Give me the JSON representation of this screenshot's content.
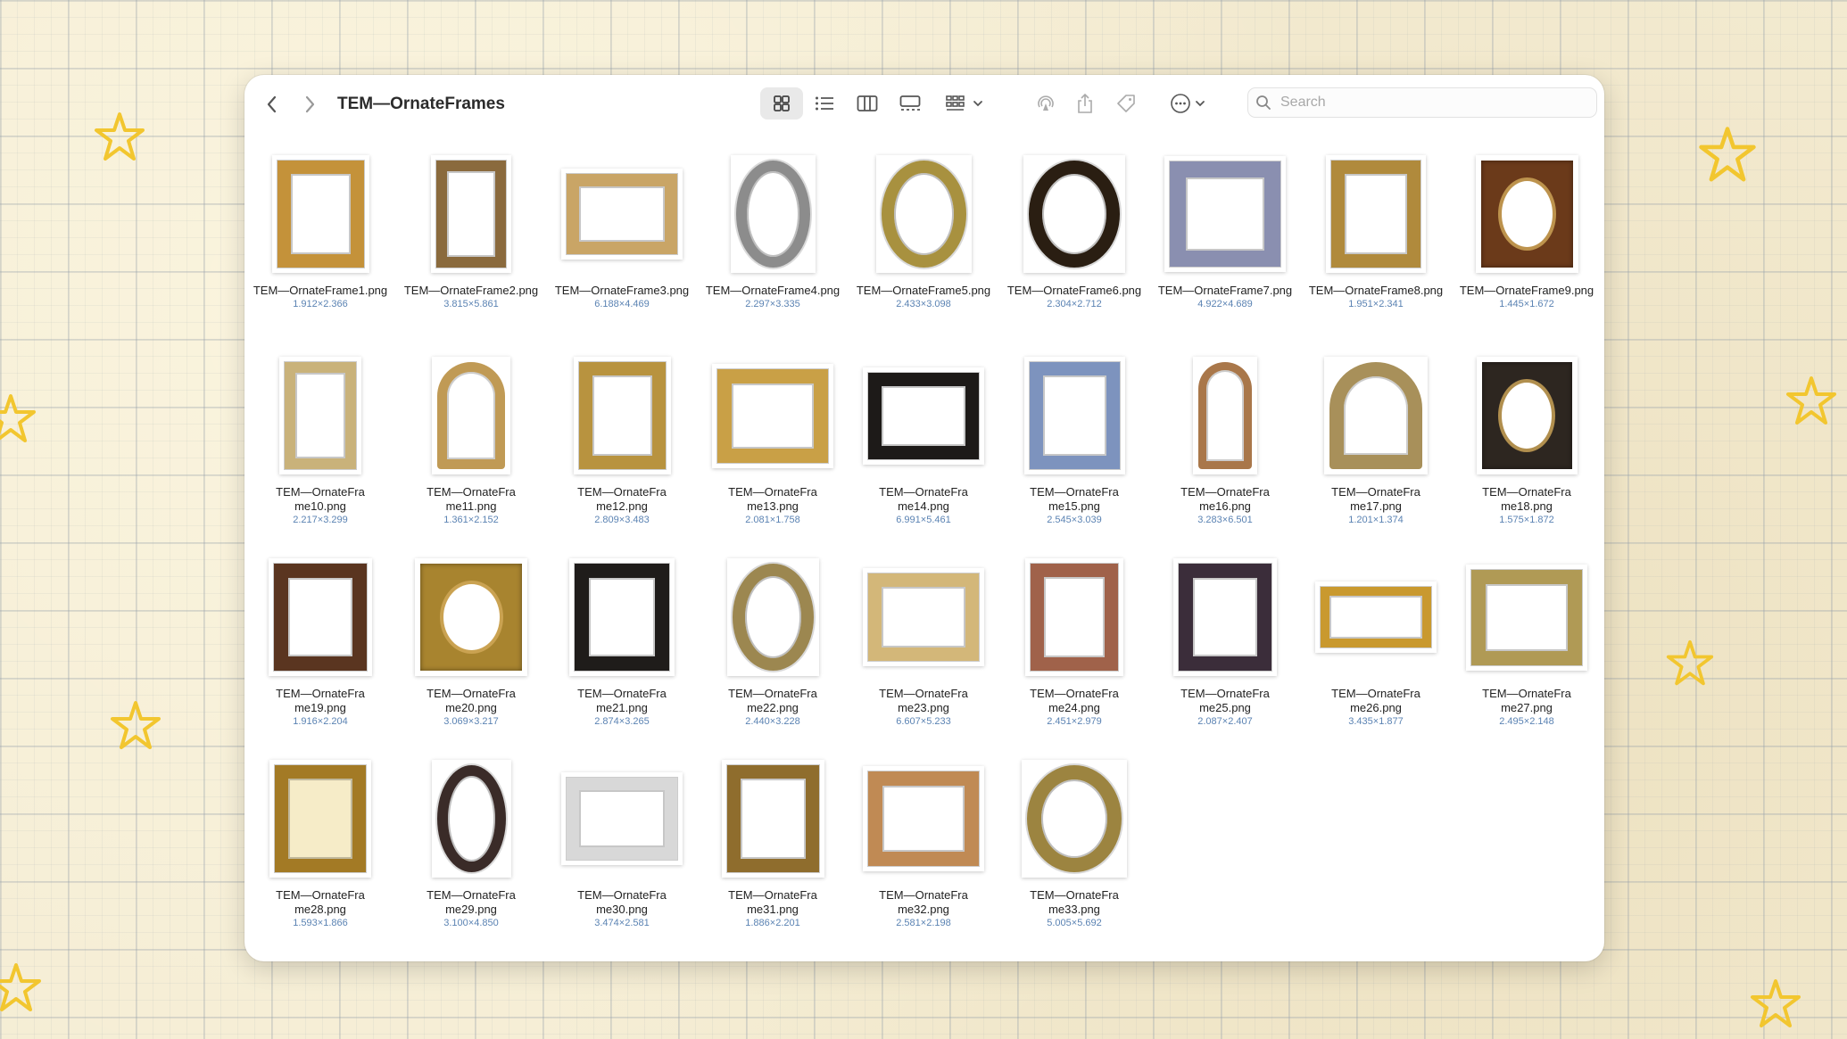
{
  "window": {
    "title": "TEM—OrnateFrames",
    "search_placeholder": "Search"
  },
  "toolbar": {
    "back_icon": "chevron-left-icon",
    "forward_icon": "chevron-right-icon",
    "view_icons": [
      "icon-view-icon",
      "list-view-icon",
      "column-view-icon",
      "gallery-view-icon"
    ],
    "group_icon": "group-icon",
    "airdrop_icon": "airdrop-icon",
    "share_icon": "share-icon",
    "tag_icon": "tag-icon",
    "more_icon": "more-icon"
  },
  "colors": {
    "window_bg": "#ffffff",
    "dims_text": "#5b83b3",
    "selected_view_bg": "#e9e9e9",
    "paper_bg": "#f4ecd3",
    "star": "#f2c62f"
  },
  "files": [
    {
      "name": "TEM—OrnateFrame1.png",
      "dims": "1.912×2.366",
      "style": {
        "color": "#c4923a",
        "shape": "rect",
        "ratio": 0.81,
        "inner": "#ffffff"
      }
    },
    {
      "name": "TEM—OrnateFrame2.png",
      "dims": "3.815×5.861",
      "style": {
        "color": "#8a6a3d",
        "shape": "rect",
        "ratio": 0.65,
        "inner": "#ffffff"
      }
    },
    {
      "name": "TEM—OrnateFrame3.png",
      "dims": "6.188×4.469",
      "style": {
        "color": "#c9a566",
        "shape": "rect",
        "ratio": 1.38,
        "inner": "#ffffff"
      }
    },
    {
      "name": "TEM—OrnateFrame4.png",
      "dims": "2.297×3.335",
      "style": {
        "color": "#8c8c8c",
        "shape": "oval",
        "ratio": 0.69,
        "inner": "#ffffff"
      }
    },
    {
      "name": "TEM—OrnateFrame5.png",
      "dims": "2.433×3.098",
      "style": {
        "color": "#a8913f",
        "shape": "oval",
        "ratio": 0.79,
        "inner": "#ffffff"
      }
    },
    {
      "name": "TEM—OrnateFrame6.png",
      "dims": "2.304×2.712",
      "style": {
        "color": "#2a1e12",
        "shape": "oval",
        "ratio": 0.85,
        "inner": "#ffffff"
      }
    },
    {
      "name": "TEM—OrnateFrame7.png",
      "dims": "4.922×4.689",
      "style": {
        "color": "#8a8fb0",
        "shape": "rect",
        "ratio": 1.05,
        "inner": "#ffffff"
      }
    },
    {
      "name": "TEM—OrnateFrame8.png",
      "dims": "1.951×2.341",
      "style": {
        "color": "#b08a3c",
        "shape": "rect",
        "ratio": 0.83,
        "inner": "#ffffff"
      }
    },
    {
      "name": "TEM—OrnateFrame9.png",
      "dims": "1.445×1.672",
      "style": {
        "color": "#6b3a1a",
        "shape": "oval-in-rect",
        "ratio": 0.86,
        "inner": "#ffffff"
      }
    },
    {
      "name": "TEM—OrnateFrame10.png",
      "dims": "2.217×3.299",
      "style": {
        "color": "#c9b27a",
        "shape": "rect",
        "ratio": 0.67,
        "inner": "#ffffff"
      }
    },
    {
      "name": "TEM—OrnateFrame11.png",
      "dims": "1.361×2.152",
      "style": {
        "color": "#c09a55",
        "shape": "arch",
        "ratio": 0.63,
        "inner": "#ffffff"
      }
    },
    {
      "name": "TEM—OrnateFrame12.png",
      "dims": "2.809×3.483",
      "style": {
        "color": "#b8933f",
        "shape": "rect",
        "ratio": 0.81,
        "inner": "#ffffff"
      }
    },
    {
      "name": "TEM—OrnateFrame13.png",
      "dims": "2.081×1.758",
      "style": {
        "color": "#c9a046",
        "shape": "rect",
        "ratio": 1.18,
        "inner": "#ffffff"
      }
    },
    {
      "name": "TEM—OrnateFrame14.png",
      "dims": "6.991×5.461",
      "style": {
        "color": "#1d1a18",
        "shape": "rect",
        "ratio": 1.28,
        "inner": "#ffffff"
      }
    },
    {
      "name": "TEM—OrnateFrame15.png",
      "dims": "2.545×3.039",
      "style": {
        "color": "#7d93be",
        "shape": "rect",
        "ratio": 0.84,
        "inner": "#ffffff"
      }
    },
    {
      "name": "TEM—OrnateFrame16.png",
      "dims": "3.283×6.501",
      "style": {
        "color": "#a9774a",
        "shape": "arch",
        "ratio": 0.5,
        "inner": "#ffffff"
      }
    },
    {
      "name": "TEM—OrnateFrame17.png",
      "dims": "1.201×1.374",
      "style": {
        "color": "#a8905a",
        "shape": "arch",
        "ratio": 0.87,
        "inner": "#ffffff"
      }
    },
    {
      "name": "TEM—OrnateFrame18.png",
      "dims": "1.575×1.872",
      "style": {
        "color": "#2d2620",
        "shape": "oval-in-rect",
        "ratio": 0.84,
        "inner": "#ffffff"
      }
    },
    {
      "name": "TEM—OrnateFrame19.png",
      "dims": "1.916×2.204",
      "style": {
        "color": "#5a3520",
        "shape": "rect",
        "ratio": 0.87,
        "inner": "#ffffff"
      }
    },
    {
      "name": "TEM—OrnateFrame20.png",
      "dims": "3.069×3.217",
      "style": {
        "color": "#a8842f",
        "shape": "oval-in-rect",
        "ratio": 0.95,
        "inner": "#ffffff"
      }
    },
    {
      "name": "TEM—OrnateFrame21.png",
      "dims": "2.874×3.265",
      "style": {
        "color": "#1f1c1a",
        "shape": "rect",
        "ratio": 0.88,
        "inner": "#ffffff"
      }
    },
    {
      "name": "TEM—OrnateFrame22.png",
      "dims": "2.440×3.228",
      "style": {
        "color": "#9c8750",
        "shape": "oval",
        "ratio": 0.76,
        "inner": "#ffffff"
      }
    },
    {
      "name": "TEM—OrnateFrame23.png",
      "dims": "6.607×5.233",
      "style": {
        "color": "#d3b779",
        "shape": "rect",
        "ratio": 1.26,
        "inner": "#ffffff"
      }
    },
    {
      "name": "TEM—OrnateFrame24.png",
      "dims": "2.451×2.979",
      "style": {
        "color": "#a0624a",
        "shape": "rect",
        "ratio": 0.82,
        "inner": "#ffffff"
      }
    },
    {
      "name": "TEM—OrnateFrame25.png",
      "dims": "2.087×2.407",
      "style": {
        "color": "#3b2d3a",
        "shape": "rect",
        "ratio": 0.87,
        "inner": "#ffffff"
      }
    },
    {
      "name": "TEM—OrnateFrame26.png",
      "dims": "3.435×1.877",
      "style": {
        "color": "#c9992f",
        "shape": "rect",
        "ratio": 1.83,
        "inner": "#ffffff"
      }
    },
    {
      "name": "TEM—OrnateFrame27.png",
      "dims": "2.495×2.148",
      "style": {
        "color": "#b09a55",
        "shape": "rect",
        "ratio": 1.16,
        "inner": "#ffffff"
      }
    },
    {
      "name": "TEM—OrnateFrame28.png",
      "dims": "1.593×1.866",
      "style": {
        "color": "#a37a25",
        "shape": "rect",
        "ratio": 0.85,
        "inner": "#f6ecc8"
      }
    },
    {
      "name": "TEM—OrnateFrame29.png",
      "dims": "3.100×4.850",
      "style": {
        "color": "#3a2b28",
        "shape": "oval",
        "ratio": 0.64,
        "inner": "#ffffff"
      }
    },
    {
      "name": "TEM—OrnateFrame30.png",
      "dims": "3.474×2.581",
      "style": {
        "color": "#d8d8d8",
        "shape": "rect",
        "ratio": 1.35,
        "inner": "#ffffff"
      }
    },
    {
      "name": "TEM—OrnateFrame31.png",
      "dims": "1.886×2.201",
      "style": {
        "color": "#8f6d2d",
        "shape": "rect",
        "ratio": 0.86,
        "inner": "#ffffff"
      }
    },
    {
      "name": "TEM—OrnateFrame32.png",
      "dims": "2.581×2.198",
      "style": {
        "color": "#c08a54",
        "shape": "rect",
        "ratio": 1.17,
        "inner": "#ffffff"
      }
    },
    {
      "name": "TEM—OrnateFrame33.png",
      "dims": "5.005×5.692",
      "style": {
        "color": "#9c8440",
        "shape": "oval",
        "ratio": 0.88,
        "inner": "#ffffff"
      }
    }
  ]
}
